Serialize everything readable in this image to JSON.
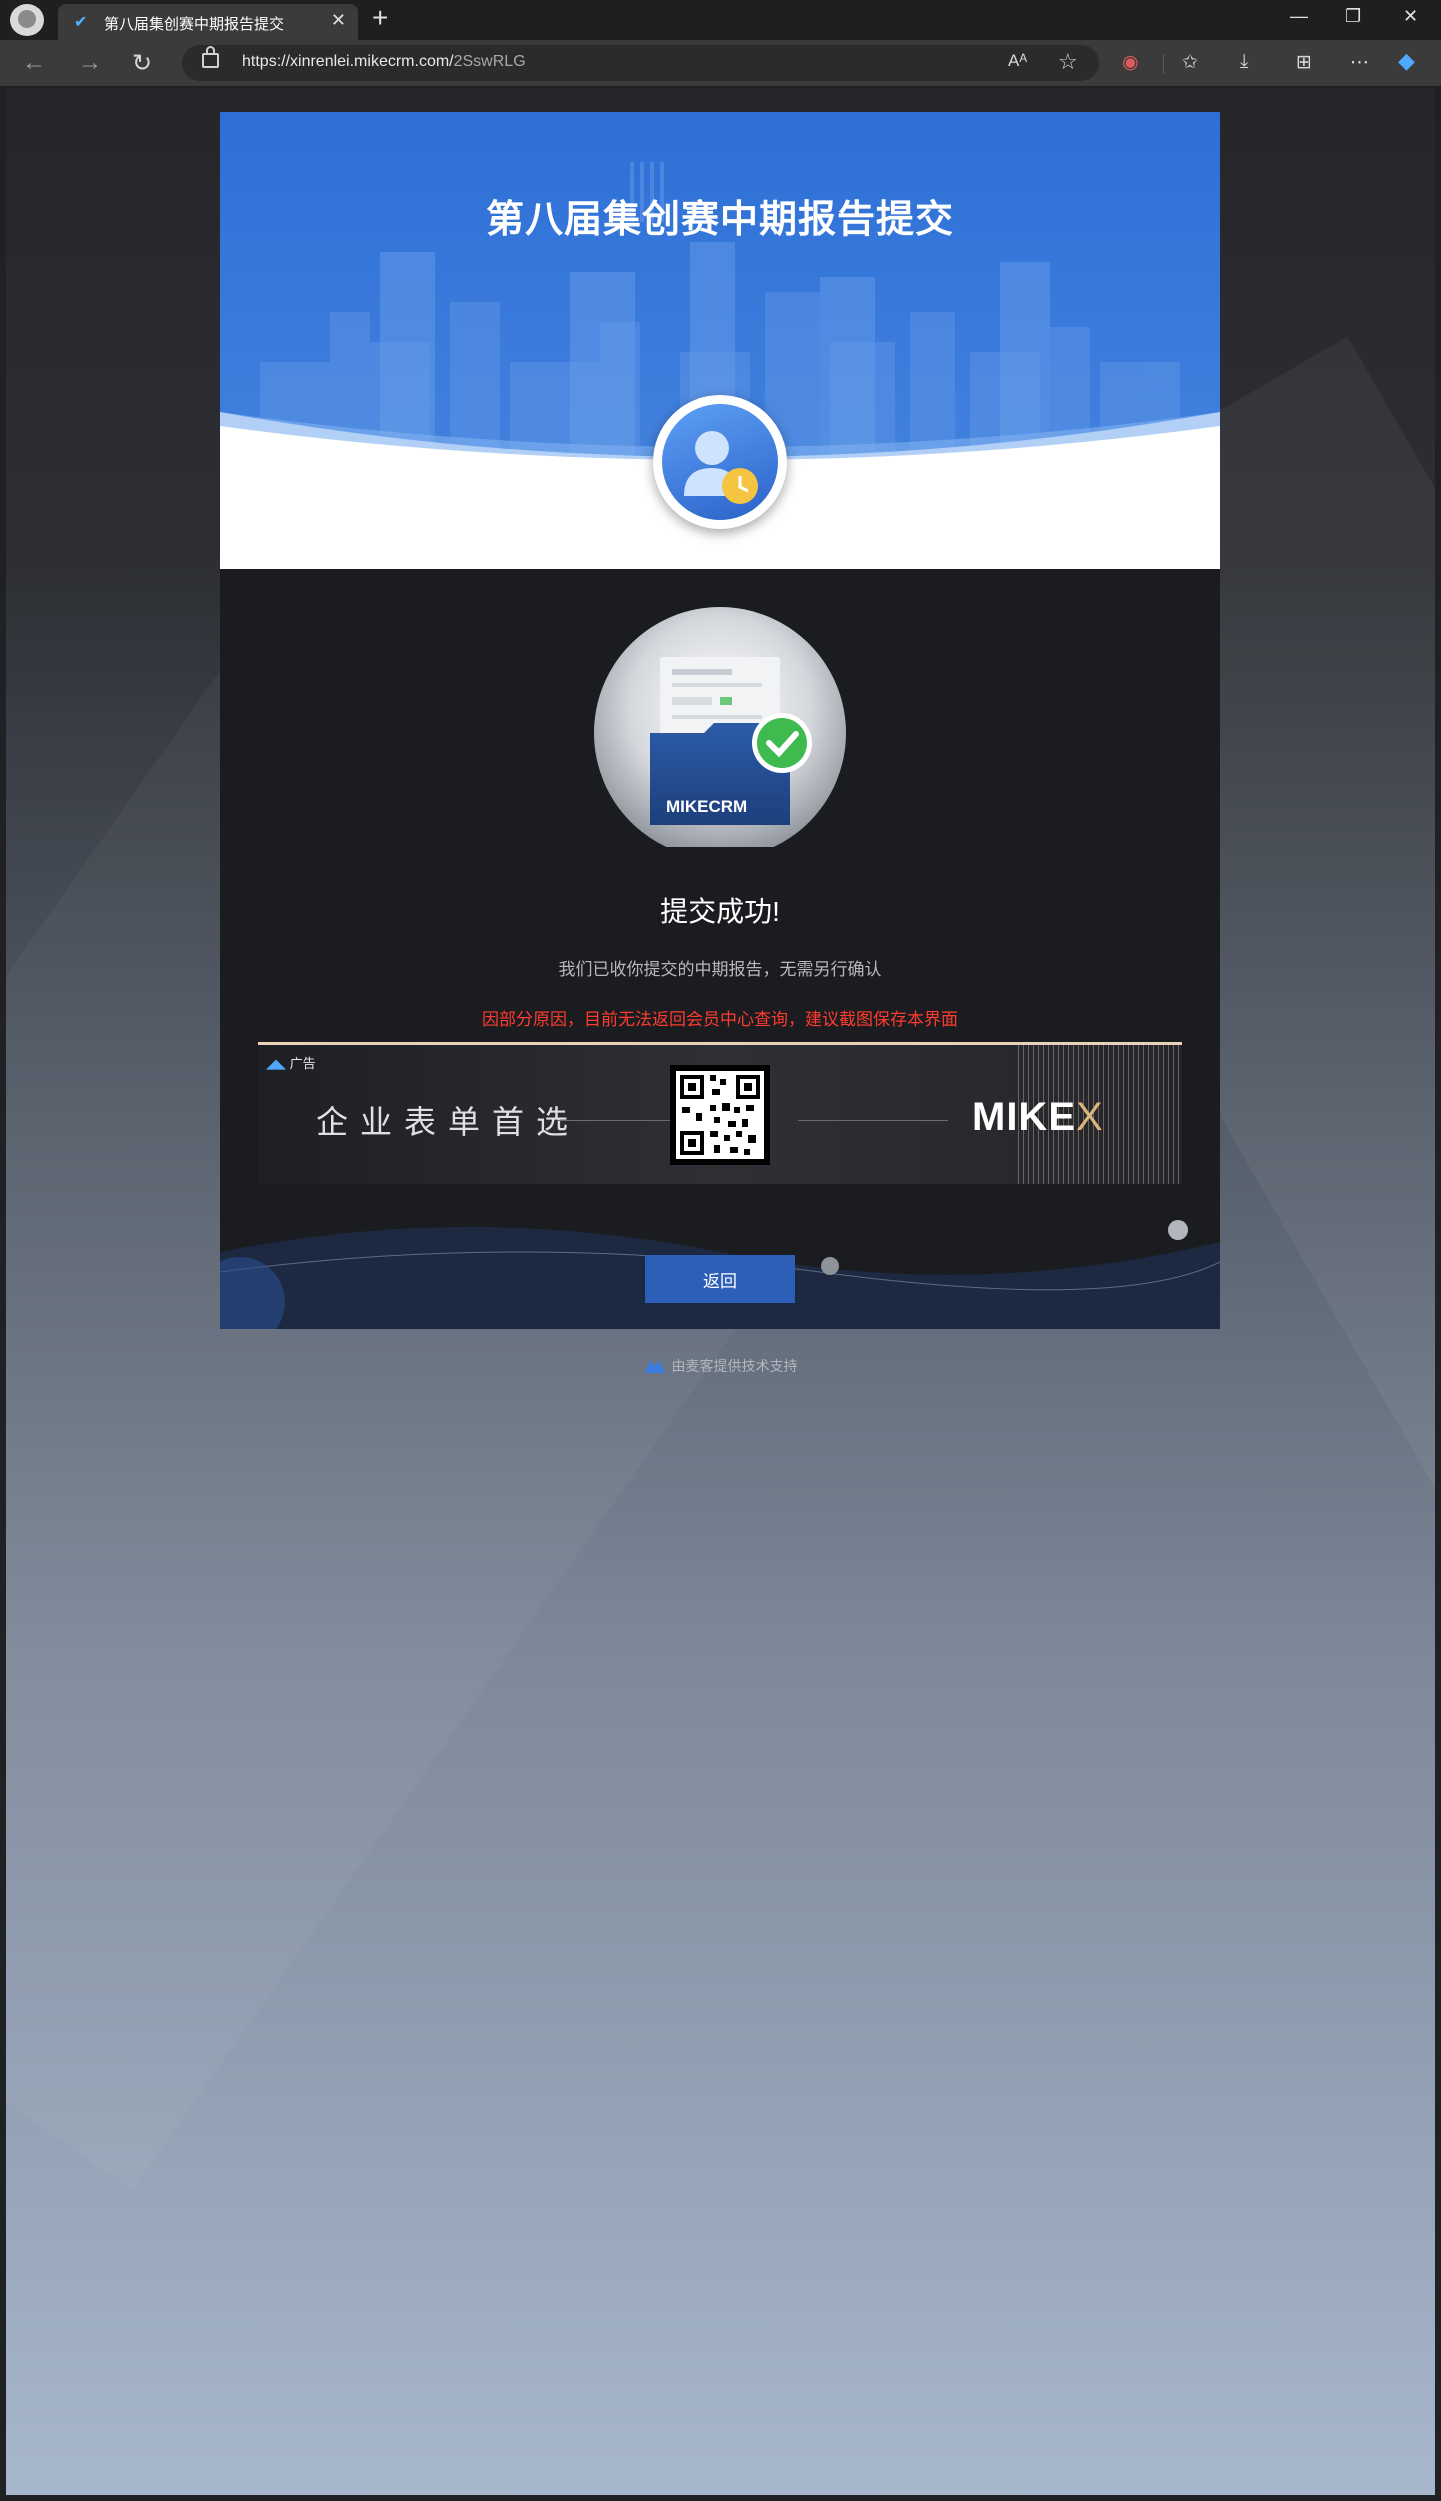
{
  "browser": {
    "tab_title": "第八届集创赛中期报告提交",
    "url_host": "https://xinrenlei.mikecrm.com/",
    "url_path": "2SswRLG",
    "read_aloud_glyph": "Aᴬ"
  },
  "page": {
    "banner_title": "第八届集创赛中期报告提交",
    "folder_brand": "MIKECRM",
    "success_title": "提交成功!",
    "success_message": "我们已收你提交的中期报告，无需另行确认",
    "warning_message": "因部分原因，目前无法返回会员中心查询，建议截图保存本界面",
    "ad": {
      "tag": "广告",
      "slogan": "企业表单首选",
      "brand_main": "MIKE",
      "brand_x": "X"
    },
    "back_button": "返回",
    "footer": "由麦客提供技术支持"
  },
  "colors": {
    "banner_blue": "#3b7cdc",
    "card_dark": "#1b1c1f",
    "warning_red": "#ff3b30",
    "button_blue": "#2d5fb8",
    "success_green": "#3fba4f"
  }
}
